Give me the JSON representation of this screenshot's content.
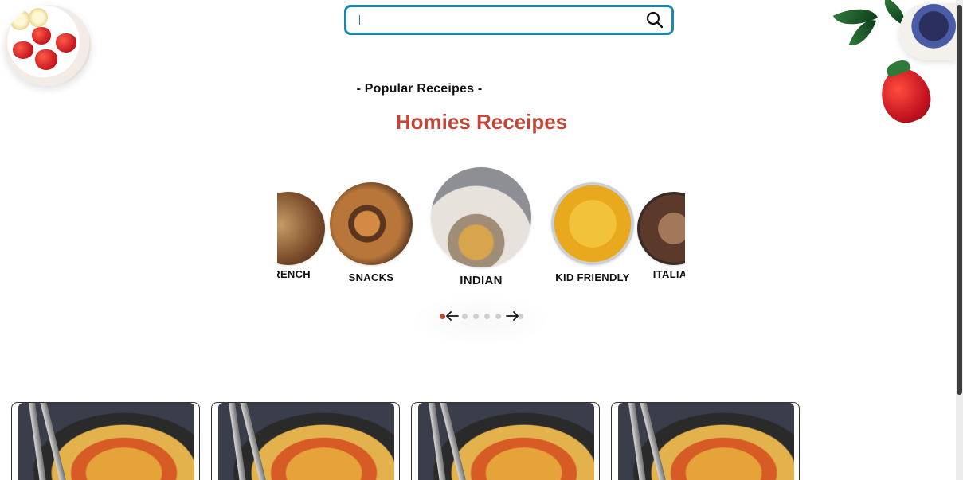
{
  "search": {
    "value": "",
    "placeholder": ""
  },
  "section": {
    "eyebrow": "- Popular Receipes -",
    "title": "Homies Receipes"
  },
  "carousel": {
    "categories": [
      {
        "label": "FRENCH"
      },
      {
        "label": "SNACKS"
      },
      {
        "label": "INDIAN"
      },
      {
        "label": "KID FRIENDLY"
      },
      {
        "label": "ITALIAN"
      }
    ],
    "pager": {
      "total": 6,
      "active_index": 0
    }
  },
  "colors": {
    "accent": "#c0483b",
    "search_border": "#1b87ad"
  }
}
